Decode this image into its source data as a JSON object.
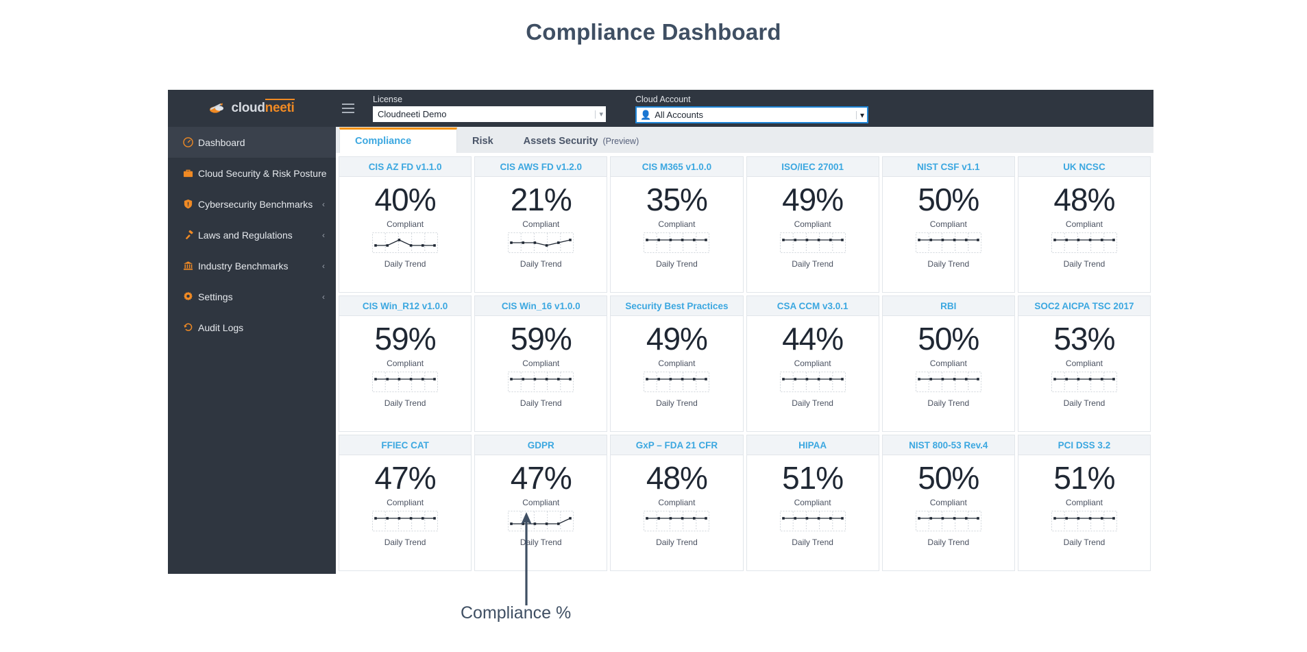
{
  "page": {
    "title": "Compliance Dashboard"
  },
  "brand": {
    "logo_icon": "cloudneeti-logo-icon",
    "name_part1": "cloud",
    "name_part2": "neeti"
  },
  "topbar": {
    "menu_icon": "hamburger-icon",
    "license": {
      "label": "License",
      "value": "Cloudneeti Demo",
      "caret_icon": "chevron-down-icon"
    },
    "cloud_account": {
      "label": "Cloud Account",
      "value": "All Accounts",
      "account_icon": "person-icon",
      "caret_icon": "chevron-down-icon"
    }
  },
  "sidebar": {
    "items": [
      {
        "label": "Dashboard",
        "icon": "gauge-icon",
        "active": true,
        "chevron": ""
      },
      {
        "label": "Cloud Security & Risk Posture",
        "icon": "briefcase-icon",
        "active": false,
        "chevron": ""
      },
      {
        "label": "Cybersecurity Benchmarks",
        "icon": "shield-icon",
        "active": false,
        "chevron": "‹"
      },
      {
        "label": "Laws and Regulations",
        "icon": "gavel-icon",
        "active": false,
        "chevron": "‹"
      },
      {
        "label": "Industry Benchmarks",
        "icon": "bank-icon",
        "active": false,
        "chevron": "‹"
      },
      {
        "label": "Settings",
        "icon": "gear-icon",
        "active": false,
        "chevron": "‹"
      },
      {
        "label": "Audit Logs",
        "icon": "history-icon",
        "active": false,
        "chevron": ""
      }
    ]
  },
  "tabs": [
    {
      "label": "Compliance",
      "sub": "",
      "active": true
    },
    {
      "label": "Risk",
      "sub": "",
      "active": false
    },
    {
      "label": "Assets Security",
      "sub": "(Preview)",
      "active": false
    }
  ],
  "card_labels": {
    "compliant": "Compliant",
    "daily_trend": "Daily Trend"
  },
  "annotation": {
    "label": "Compliance %",
    "arrow_icon": "up-arrow-icon"
  },
  "colors": {
    "brand_orange": "#f08a24",
    "title_blue": "#3ba7e0",
    "sidebar_bg": "#2f3640",
    "focus_blue": "#1f86d8",
    "annotation": "#3f4f63"
  },
  "chart_data": {
    "type": "line",
    "title": "Compliance Dashboard — Daily Trend sparklines",
    "xlabel": "Daily Trend",
    "ylabel": "Compliant %",
    "grid": true,
    "legend": "none",
    "points_per_sparkline": 6,
    "cards": [
      {
        "title": "CIS AZ FD v1.1.0",
        "value": 40,
        "unit": "%",
        "trend": [
          40,
          40,
          41,
          40,
          40,
          40
        ]
      },
      {
        "title": "CIS AWS FD v1.2.0",
        "value": 21,
        "unit": "%",
        "trend": [
          21,
          21,
          21,
          20,
          21,
          22
        ]
      },
      {
        "title": "CIS M365 v1.0.0",
        "value": 35,
        "unit": "%",
        "trend": [
          35,
          35,
          35,
          35,
          35,
          35
        ]
      },
      {
        "title": "ISO/IEC 27001",
        "value": 49,
        "unit": "%",
        "trend": [
          49,
          49,
          49,
          49,
          49,
          49
        ]
      },
      {
        "title": "NIST CSF v1.1",
        "value": 50,
        "unit": "%",
        "trend": [
          50,
          50,
          50,
          50,
          50,
          50
        ]
      },
      {
        "title": "UK NCSC",
        "value": 48,
        "unit": "%",
        "trend": [
          48,
          48,
          48,
          48,
          48,
          48
        ]
      },
      {
        "title": "CIS Win_R12 v1.0.0",
        "value": 59,
        "unit": "%",
        "trend": [
          59,
          59,
          59,
          59,
          59,
          59
        ]
      },
      {
        "title": "CIS Win_16 v1.0.0",
        "value": 59,
        "unit": "%",
        "trend": [
          59,
          59,
          59,
          59,
          59,
          59
        ]
      },
      {
        "title": "Security Best Practices",
        "value": 49,
        "unit": "%",
        "trend": [
          49,
          49,
          49,
          49,
          49,
          49
        ]
      },
      {
        "title": "CSA CCM v3.0.1",
        "value": 44,
        "unit": "%",
        "trend": [
          44,
          44,
          44,
          44,
          44,
          44
        ]
      },
      {
        "title": "RBI",
        "value": 50,
        "unit": "%",
        "trend": [
          50,
          50,
          50,
          50,
          50,
          50
        ]
      },
      {
        "title": "SOC2 AICPA TSC 2017",
        "value": 53,
        "unit": "%",
        "trend": [
          53,
          53,
          53,
          53,
          53,
          53
        ]
      },
      {
        "title": "FFIEC CAT",
        "value": 47,
        "unit": "%",
        "trend": [
          47,
          47,
          47,
          47,
          47,
          47
        ]
      },
      {
        "title": "GDPR",
        "value": 47,
        "unit": "%",
        "trend": [
          47,
          47,
          47,
          47,
          47,
          48
        ]
      },
      {
        "title": "GxP – FDA 21 CFR",
        "value": 48,
        "unit": "%",
        "trend": [
          48,
          48,
          48,
          48,
          48,
          48
        ]
      },
      {
        "title": "HIPAA",
        "value": 51,
        "unit": "%",
        "trend": [
          51,
          51,
          51,
          51,
          51,
          51
        ]
      },
      {
        "title": "NIST 800-53 Rev.4",
        "value": 50,
        "unit": "%",
        "trend": [
          50,
          50,
          50,
          50,
          50,
          50
        ]
      },
      {
        "title": "PCI DSS 3.2",
        "value": 51,
        "unit": "%",
        "trend": [
          51,
          51,
          51,
          51,
          51,
          51
        ]
      }
    ]
  }
}
